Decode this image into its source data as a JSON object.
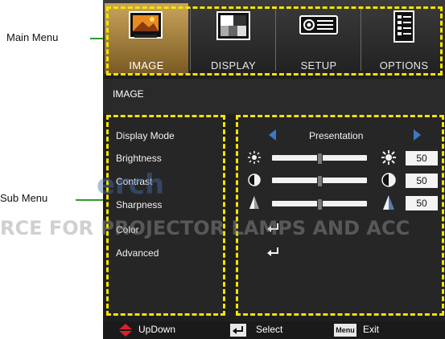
{
  "annotations": {
    "main_menu": "Main Menu",
    "sub_menu": "Sub Menu"
  },
  "tabs": [
    {
      "label": "IMAGE",
      "icon": "image-icon",
      "active": true
    },
    {
      "label": "DISPLAY",
      "icon": "display-icon",
      "active": false
    },
    {
      "label": "SETUP",
      "icon": "projector-icon",
      "active": false
    },
    {
      "label": "OPTIONS",
      "icon": "options-icon",
      "active": false
    }
  ],
  "section_title": "IMAGE",
  "menu_items": [
    "Display Mode",
    "Brightness",
    "Contrast",
    "Sharpness",
    "Color",
    "Advanced"
  ],
  "display_mode_value": "Presentation",
  "brightness_value": "50",
  "contrast_value": "50",
  "sharpness_value": "50",
  "footer": {
    "updown": "UpDown",
    "select": "Select",
    "menu_key": "Menu",
    "exit": "Exit"
  },
  "watermark": {
    "line1": "erch",
    "line2": "RCE FOR PROJECTOR LAMPS AND ACC"
  },
  "colors": {
    "highlight": "#f4e400",
    "active_tab": "#c9a45a",
    "annotation": "#2e9a2e"
  }
}
